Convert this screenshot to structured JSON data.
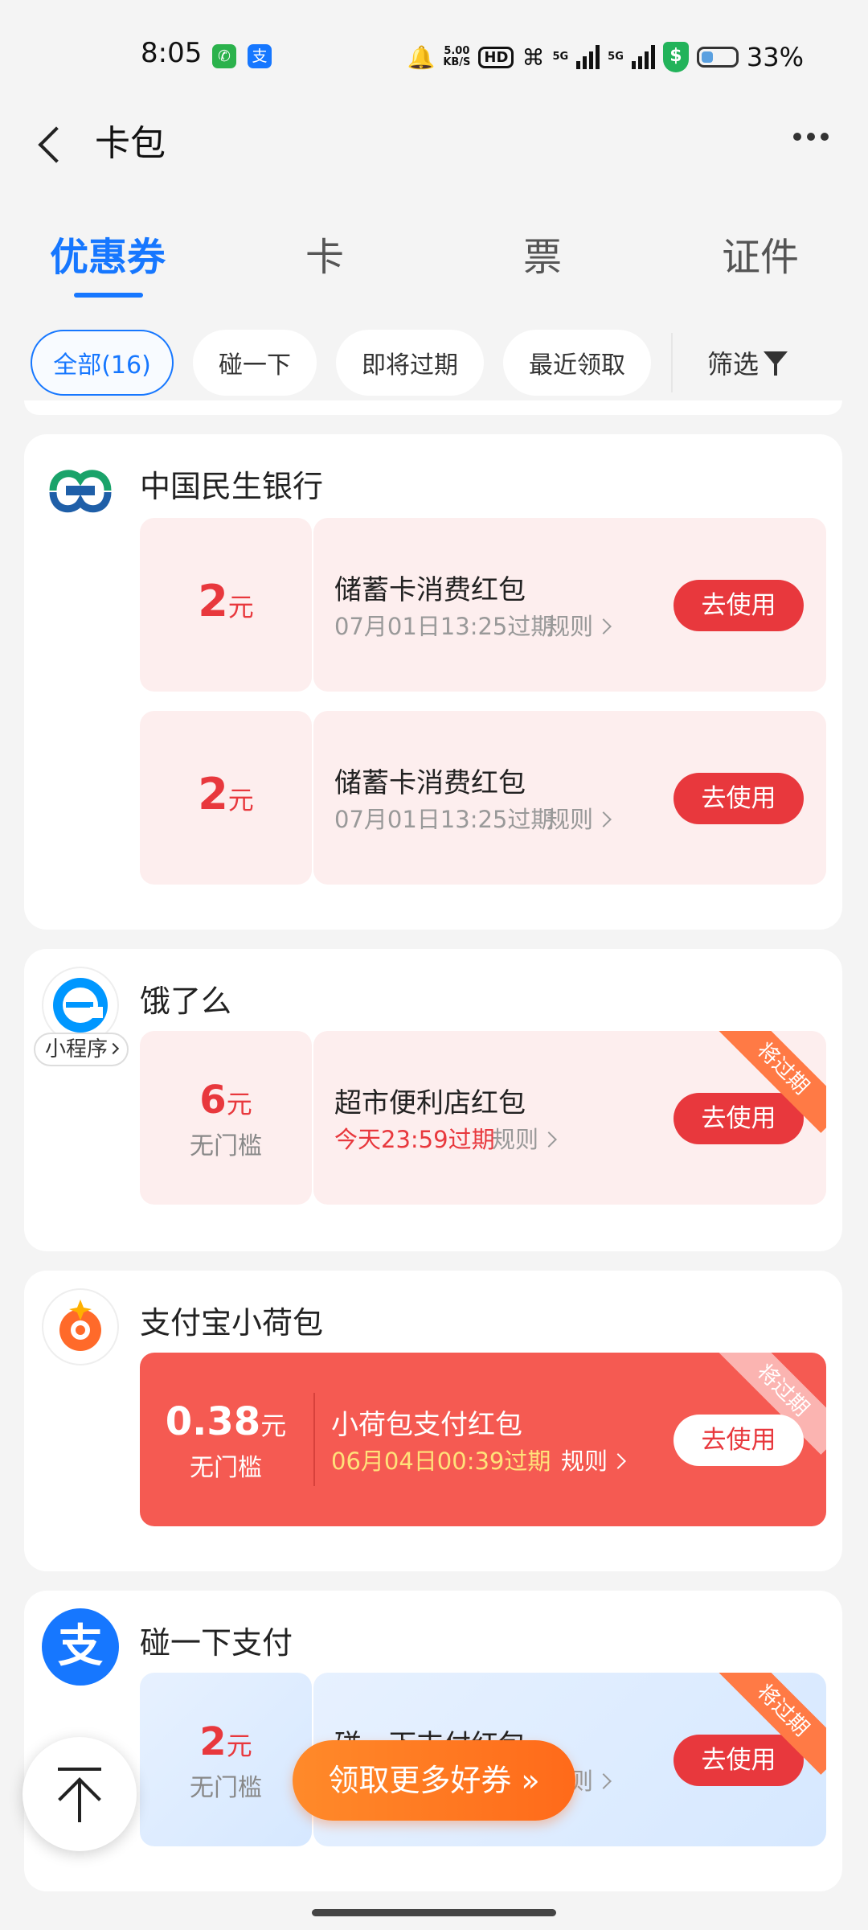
{
  "status_bar": {
    "time": "8:05",
    "phone_app_icon": "phone-icon",
    "alipay_app_icon": "支",
    "net_speed_value": "5.00",
    "net_speed_unit": "KB/S",
    "hd_label": "HD",
    "signal1_label": "5G",
    "signal2_label": "5G",
    "shield_label": "$",
    "battery_percent": "33%"
  },
  "header": {
    "title": "卡包"
  },
  "tabs": [
    {
      "label": "优惠券",
      "active": true
    },
    {
      "label": "卡",
      "active": false
    },
    {
      "label": "票",
      "active": false
    },
    {
      "label": "证件",
      "active": false
    }
  ],
  "filters": {
    "chips": [
      "全部(16)",
      "碰一下",
      "即将过期",
      "最近领取"
    ],
    "filter_label": "筛选"
  },
  "cards": [
    {
      "merchant": "中国民生银行",
      "coupons": [
        {
          "amount": "2",
          "unit": "元",
          "title": "储蓄卡消费红包",
          "expire": "07月01日13:25过期",
          "rule": "规则",
          "button": "去使用"
        },
        {
          "amount": "2",
          "unit": "元",
          "title": "储蓄卡消费红包",
          "expire": "07月01日13:25过期",
          "rule": "规则",
          "button": "去使用"
        }
      ]
    },
    {
      "merchant": "饿了么",
      "tag": "小程序",
      "coupons": [
        {
          "amount": "6",
          "unit": "元",
          "sub": "无门槛",
          "title": "超市便利店红包",
          "expire": "今天23:59过期",
          "rule": "规则",
          "button": "去使用",
          "ribbon": "将过期"
        }
      ]
    },
    {
      "merchant": "支付宝小荷包",
      "coupons": [
        {
          "amount": "0.38",
          "unit": "元",
          "sub": "无门槛",
          "title": "小荷包支付红包",
          "expire": "06月04日00:39过期",
          "rule": "规则",
          "button": "去使用",
          "ribbon": "将过期"
        }
      ]
    },
    {
      "merchant": "碰一下支付",
      "logo_text": "支",
      "coupons": [
        {
          "amount": "2",
          "unit": "元",
          "sub": "无门槛",
          "title": "碰一下支付红包",
          "rule": "规则",
          "button": "去使用",
          "ribbon": "将过期"
        }
      ]
    }
  ],
  "floating": {
    "more_coupons": "领取更多好券 »"
  },
  "colors": {
    "accent": "#1677ff",
    "red": "#e8383d",
    "coupon_bg": "#fdeeee",
    "red_coupon": "#f55a52",
    "orange": "#ff7a45"
  }
}
